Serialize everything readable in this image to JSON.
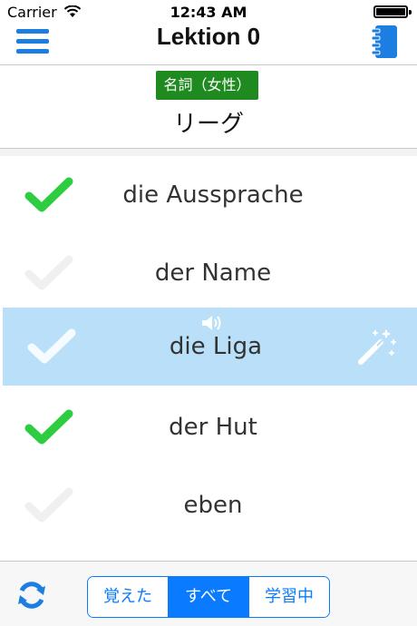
{
  "status_bar": {
    "carrier": "Carrier",
    "time": "12:43 AM"
  },
  "nav": {
    "title": "Lektion 0",
    "menu_icon": "hamburger-menu-icon",
    "right_icon": "notebook-icon"
  },
  "word_header": {
    "part_of_speech": "名詞（女性）",
    "reading": "リーグ"
  },
  "word_list": {
    "items": [
      {
        "word": "die Aussprache",
        "learned": true
      },
      {
        "word": "der Name",
        "learned": false
      },
      {
        "word": "die Liga",
        "learned": false,
        "selected": true
      },
      {
        "word": "der Hut",
        "learned": true
      },
      {
        "word": "eben",
        "learned": false
      }
    ],
    "speaker_icon": "speaker-icon",
    "magic_icon": "magic-wand-icon"
  },
  "toolbar": {
    "refresh_icon": "refresh-icon",
    "segments": [
      "覚えた",
      "すべて",
      "学習中"
    ],
    "active_segment": "すべて"
  },
  "colors": {
    "accent": "#0a7bff",
    "learned_check": "#2ecc40",
    "unlearned_check": "#f0f0f0",
    "selected_row": "#b9e0f8",
    "badge": "#1f8a1f"
  }
}
